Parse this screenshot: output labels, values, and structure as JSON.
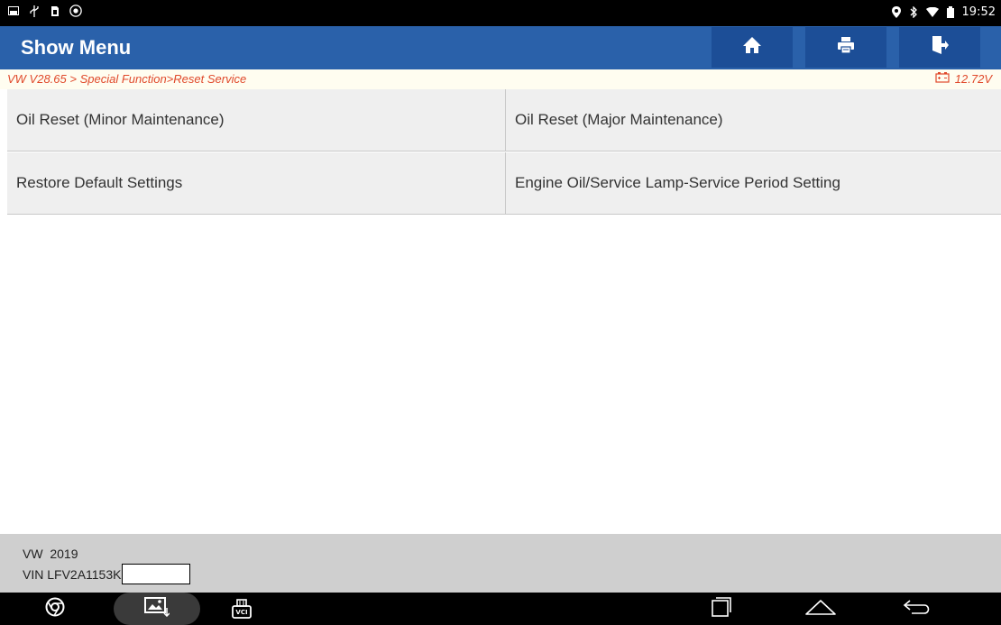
{
  "status_bar": {
    "left_icons": [
      "screen-icon",
      "usb-icon",
      "sim-icon",
      "signal-circle-icon"
    ],
    "right_icons": [
      "location-icon",
      "bluetooth-icon",
      "wifi-icon",
      "battery-icon"
    ],
    "time": "19:52"
  },
  "header": {
    "title": "Show Menu",
    "buttons": [
      "home-icon",
      "print-icon",
      "exit-icon"
    ],
    "color": "#2a61aa"
  },
  "breadcrumb": {
    "path": "VW V28.65 > Special Function>Reset Service",
    "voltage": "12.72V",
    "color": "#e0492b"
  },
  "menu": {
    "items": [
      "Oil Reset (Minor Maintenance)",
      "Oil Reset (Major Maintenance)",
      "Restore Default Settings",
      "Engine Oil/Service Lamp-Service Period Setting"
    ]
  },
  "vehicle": {
    "make_year": "VW  2019",
    "vin": "VIN LFV2A1153K"
  },
  "nav_bar": {
    "icons": [
      "chrome-icon",
      "gallery-icon",
      "vci-icon",
      "recents-icon",
      "home-nav-icon",
      "back-icon"
    ],
    "vci_label": "VCI"
  }
}
